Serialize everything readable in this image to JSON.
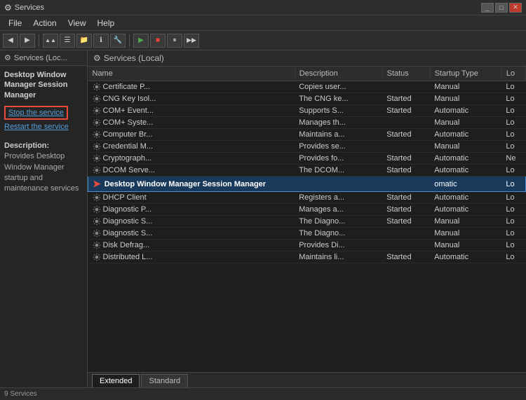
{
  "window": {
    "title": "Services",
    "title_icon": "⚙"
  },
  "menu": {
    "items": [
      "File",
      "Action",
      "View",
      "Help"
    ]
  },
  "toolbar": {
    "buttons": [
      "◀",
      "▶",
      "🗂",
      "📋",
      "🔍",
      "ℹ",
      "▶",
      "⏹",
      "⏸",
      "▶▶"
    ]
  },
  "sidebar": {
    "header": "Services (Loc...",
    "selected_service": "Desktop Window Manager Session Manager",
    "links": [
      {
        "label": "Stop the service",
        "highlighted": true
      },
      {
        "label": "Restart the service"
      }
    ],
    "description_title": "Description:",
    "description_text": "Provides Desktop Window Manager startup and maintenance services"
  },
  "content": {
    "header": "Services (Local)",
    "columns": [
      "Name",
      "Description",
      "Status",
      "Startup Type",
      "Lo"
    ],
    "services": [
      {
        "name": "Certificate P...",
        "description": "Copies user...",
        "status": "",
        "startup": "Manual",
        "logon": "Lo"
      },
      {
        "name": "CNG Key Isol...",
        "description": "The CNG ke...",
        "status": "Started",
        "startup": "Manual",
        "logon": "Lo"
      },
      {
        "name": "COM+ Event...",
        "description": "Supports S...",
        "status": "Started",
        "startup": "Automatic",
        "logon": "Lo"
      },
      {
        "name": "COM+ Syste...",
        "description": "Manages th...",
        "status": "",
        "startup": "Manual",
        "logon": "Lo"
      },
      {
        "name": "Computer Br...",
        "description": "Maintains a...",
        "status": "Started",
        "startup": "Automatic",
        "logon": "Lo"
      },
      {
        "name": "Credential M...",
        "description": "Provides se...",
        "status": "",
        "startup": "Manual",
        "logon": "Lo"
      },
      {
        "name": "Cryptograph...",
        "description": "Provides fo...",
        "status": "Started",
        "startup": "Automatic",
        "logon": "Ne"
      },
      {
        "name": "DCOM Serve...",
        "description": "The DCOM...",
        "status": "Started",
        "startup": "Automatic",
        "logon": "Lo"
      },
      {
        "name": "Desktop Window Manager Session Manager",
        "description": "",
        "status": "",
        "startup": "omatic",
        "logon": "Lo",
        "selected": true
      },
      {
        "name": "DHCP Client",
        "description": "Registers a...",
        "status": "Started",
        "startup": "Automatic",
        "logon": "Lo"
      },
      {
        "name": "Diagnostic P...",
        "description": "Manages a...",
        "status": "Started",
        "startup": "Automatic",
        "logon": "Lo"
      },
      {
        "name": "Diagnostic S...",
        "description": "The Diagno...",
        "status": "Started",
        "startup": "Manual",
        "logon": "Lo"
      },
      {
        "name": "Diagnostic S...",
        "description": "The Diagno...",
        "status": "",
        "startup": "Manual",
        "logon": "Lo"
      },
      {
        "name": "Disk Defrag...",
        "description": "Provides Di...",
        "status": "",
        "startup": "Manual",
        "logon": "Lo"
      },
      {
        "name": "Distributed L...",
        "description": "Maintains li...",
        "status": "Started",
        "startup": "Automatic",
        "logon": "Lo"
      }
    ]
  },
  "tabs": [
    {
      "label": "Extended",
      "active": true
    },
    {
      "label": "Standard",
      "active": false
    }
  ],
  "statusbar": {
    "text": "9 Services"
  }
}
